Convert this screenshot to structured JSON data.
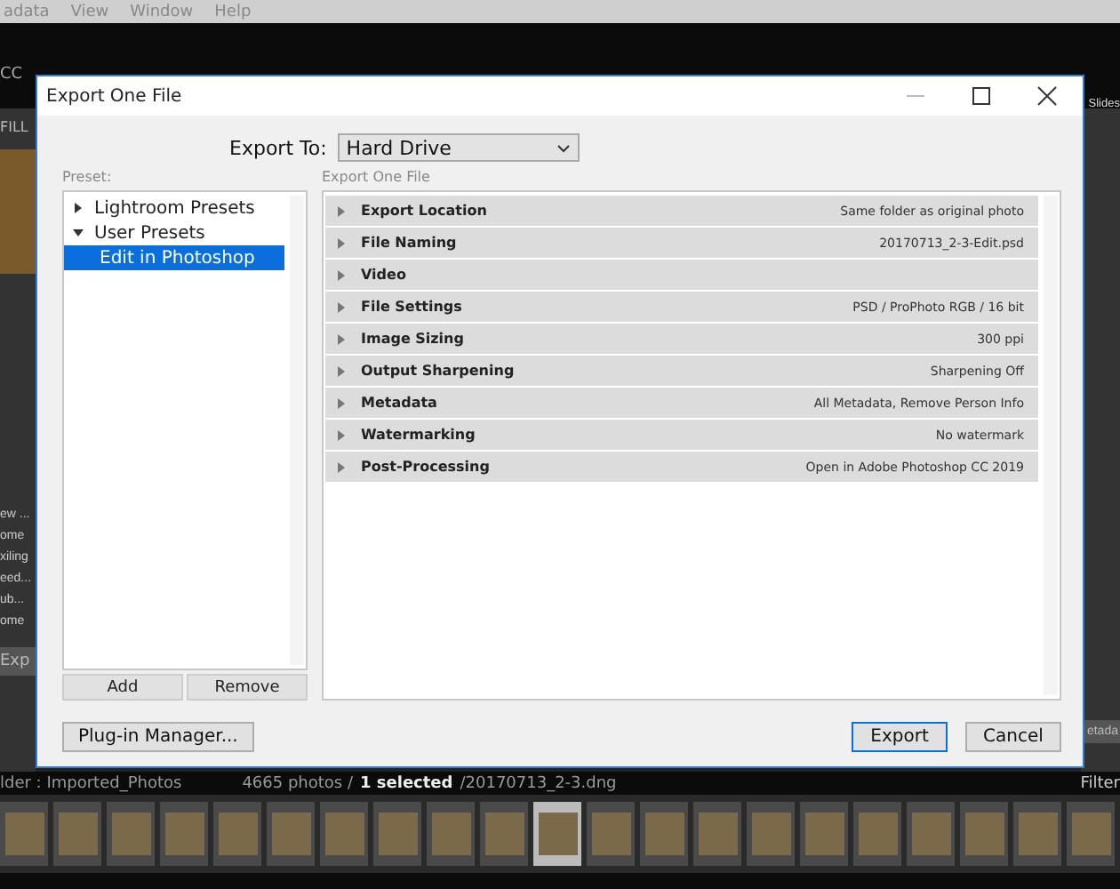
{
  "app": {
    "menu": [
      "adata",
      "View",
      "Window",
      "Help"
    ],
    "identity": "CC",
    "module": "Slides",
    "left_panel": {
      "tab": "FILL",
      "items": [
        "ew ...",
        "ome",
        "xiling",
        "eed...",
        "ub...",
        "ome"
      ],
      "button": "Exp"
    },
    "right_button": "etada",
    "status_bar": {
      "folder": "lder : Imported_Photos",
      "count": "4665 photos /",
      "selection": "1 selected",
      "file": "/20170713_2-3.dng",
      "filter": "Filter"
    },
    "filmstrip": [
      {
        "selected": false
      },
      {
        "selected": false
      },
      {
        "selected": false
      },
      {
        "selected": false
      },
      {
        "selected": false
      },
      {
        "selected": false
      },
      {
        "selected": false
      },
      {
        "selected": false
      },
      {
        "selected": false
      },
      {
        "selected": false
      },
      {
        "selected": true
      },
      {
        "selected": false
      },
      {
        "selected": false
      },
      {
        "selected": false
      },
      {
        "selected": false
      },
      {
        "selected": false
      },
      {
        "selected": false
      },
      {
        "selected": false
      },
      {
        "selected": false
      },
      {
        "selected": false
      },
      {
        "selected": false
      }
    ]
  },
  "dialog": {
    "title": "Export One File",
    "export_to_label": "Export To:",
    "export_to": "Hard Drive",
    "preset_label": "Preset:",
    "presets": [
      {
        "label": "Lightroom Presets",
        "expanded": false,
        "selected": false
      },
      {
        "label": "User Presets",
        "expanded": true,
        "selected": false,
        "children": [
          {
            "label": "Edit in Photoshop",
            "selected": true
          }
        ]
      }
    ],
    "preset_buttons": [
      "Add",
      "Remove"
    ],
    "plugin_button": "Plug-in Manager...",
    "sections_label": "Export One File",
    "sections": [
      {
        "name": "Export Location",
        "summary": "Same folder as original photo",
        "expanded": false
      },
      {
        "name": "File Naming",
        "summary": "20170713_2-3-Edit.psd",
        "expanded": false
      },
      {
        "name": "Video",
        "expanded": false
      },
      {
        "name": "File Settings",
        "summary": "PSD / ProPhoto RGB / 16 bit",
        "expanded": false
      },
      {
        "name": "Image Sizing",
        "summary": "300 ppi",
        "expanded": false
      },
      {
        "name": "Output Sharpening",
        "summary": "Sharpening Off",
        "expanded": false
      },
      {
        "name": "Metadata",
        "summary": "All Metadata, Remove Person Info",
        "expanded": false
      },
      {
        "name": "Watermarking",
        "summary": "No watermark",
        "expanded": false
      },
      {
        "name": "Post-Processing",
        "summary": "Open in Adobe Photoshop CC 2019",
        "expanded": false
      }
    ],
    "buttons": [
      {
        "label": "Export",
        "kind": "default"
      },
      {
        "label": "Cancel",
        "kind": "normal"
      }
    ]
  }
}
